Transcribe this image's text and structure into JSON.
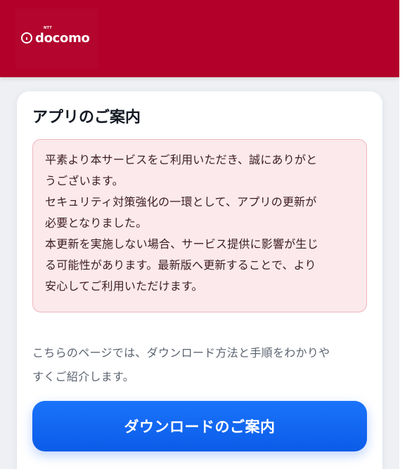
{
  "header": {
    "brand": "docomo",
    "brand_small": "NTT",
    "color": "#b2002a"
  },
  "card": {
    "title": "アプリのご案内",
    "notice_lines": [
      "平素より本サービスをご利用いただき、誠にありがと",
      "うございます。",
      "セキュリティ対策強化の一環として、アプリの更新が",
      "必要となりました。",
      "本更新を実施しない場合、サービス提供に影響が生じ",
      "る可能性があります。最新版へ更新することで、より",
      "安心してご利用いただけます。"
    ],
    "description_lines": [
      "こちらのページでは、ダウンロード方法と手順をわかりや",
      "すくご紹介します。"
    ],
    "cta_label": "ダウンロードのご案内"
  },
  "colors": {
    "header_red": "#b2002a",
    "notice_bg": "#fbe9eb",
    "notice_border": "#efb6bf",
    "cta_blue": "#0b5ce8",
    "page_bg": "#eef0f4"
  }
}
